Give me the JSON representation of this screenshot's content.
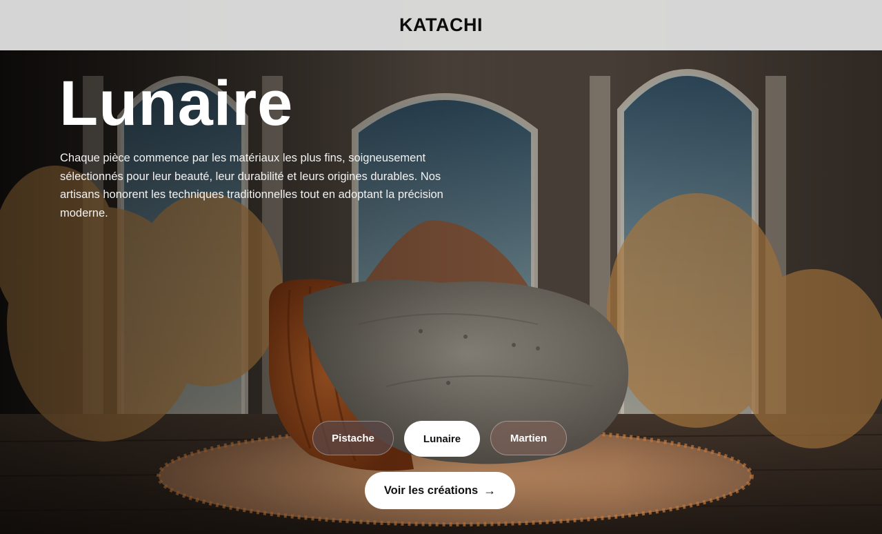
{
  "header": {
    "logo": "KATACHI"
  },
  "hero": {
    "title": "Lunaire",
    "description": "Chaque pièce commence par les matériaux les plus fins, soigneusement sélectionnés pour leur beauté, leur durabilité et leurs origines durables. Nos artisans honorent les techniques traditionnelles tout en adoptant la précision moderne."
  },
  "variants": [
    {
      "label": "Pistache",
      "selected": false
    },
    {
      "label": "Lunaire",
      "selected": true
    },
    {
      "label": "Martien",
      "selected": false
    }
  ],
  "cta": {
    "label": "Voir les créations",
    "icon": "arrow-right-icon"
  },
  "colors": {
    "header_bg": "#dcdcdc",
    "text_light": "#ffffff",
    "button_bg": "#ffffff",
    "sofa_orange": "#b5561c",
    "sofa_grey": "#8a8478"
  }
}
